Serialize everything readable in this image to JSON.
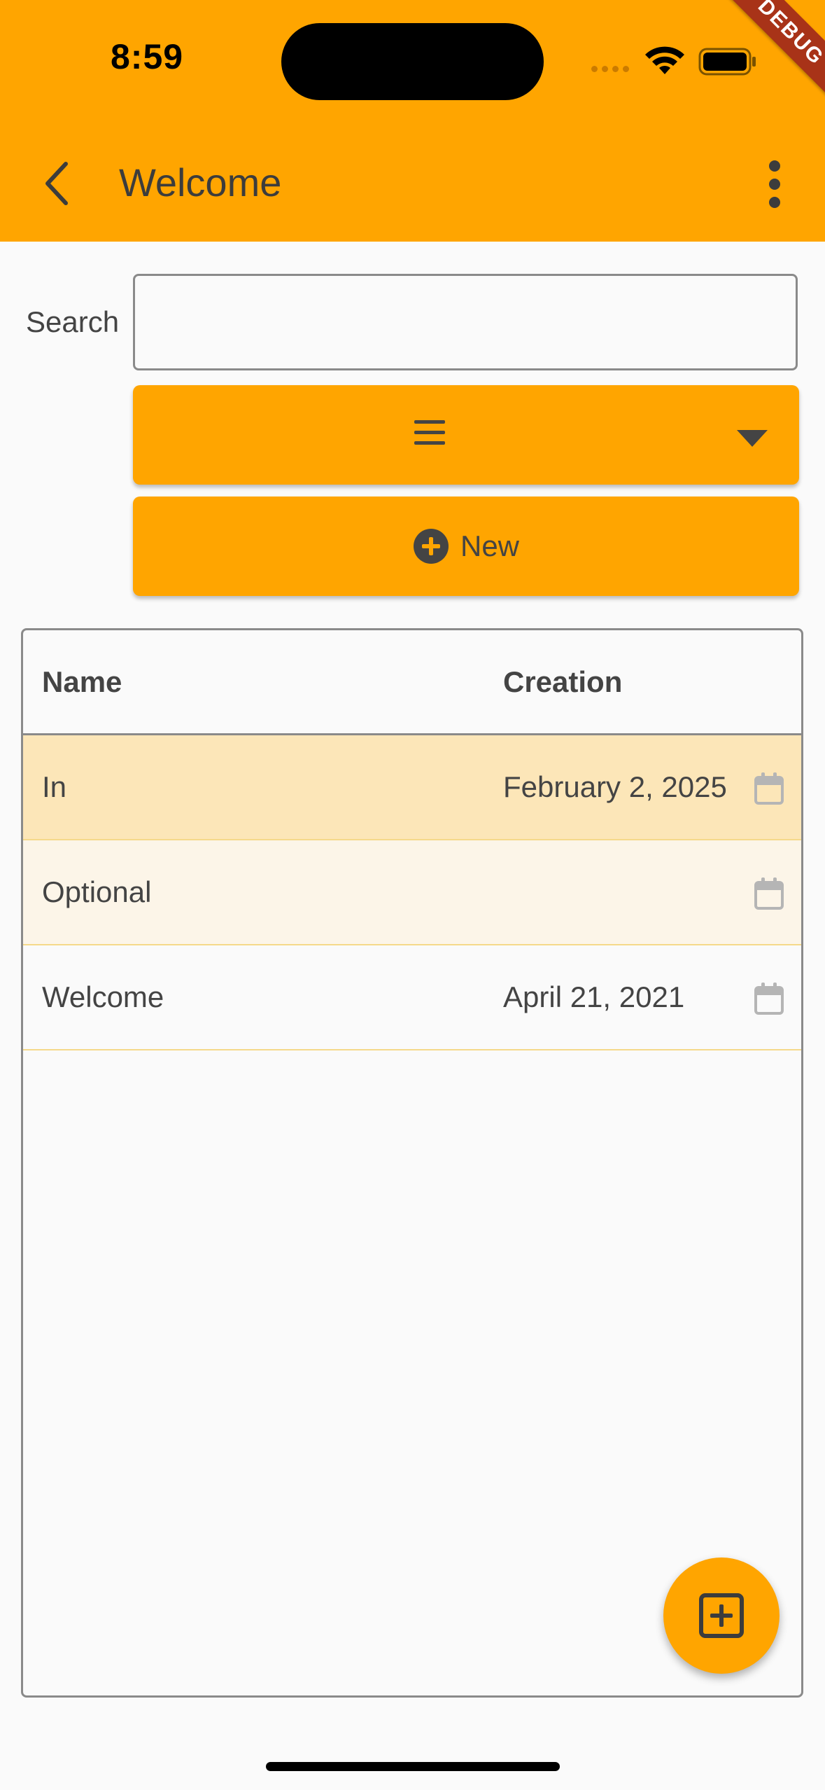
{
  "status_bar": {
    "time": "8:59"
  },
  "debug_banner": "DEBUG",
  "app_bar": {
    "title": "Welcome",
    "back_icon": "chevron-left-icon",
    "menu_icon": "more-vert-icon"
  },
  "search": {
    "label": "Search",
    "value": "",
    "placeholder": ""
  },
  "toolbar": {
    "menu_icon": "hamburger-menu-icon",
    "dropdown_icon": "caret-down-icon",
    "new_label": "New",
    "new_icon": "add-circle-icon"
  },
  "table": {
    "columns": [
      "Name",
      "Creation"
    ],
    "rows": [
      {
        "name": "In",
        "creation": "February 2, 2025",
        "selected": true
      },
      {
        "name": "Optional",
        "creation": "",
        "selected": false
      },
      {
        "name": "Welcome",
        "creation": "April 21, 2021",
        "selected": false
      }
    ]
  },
  "fab": {
    "icon": "add-box-icon"
  },
  "colors": {
    "primary": "#FFA500",
    "selected_row": "#fce6b8",
    "debug_ribbon": "#a83318"
  }
}
